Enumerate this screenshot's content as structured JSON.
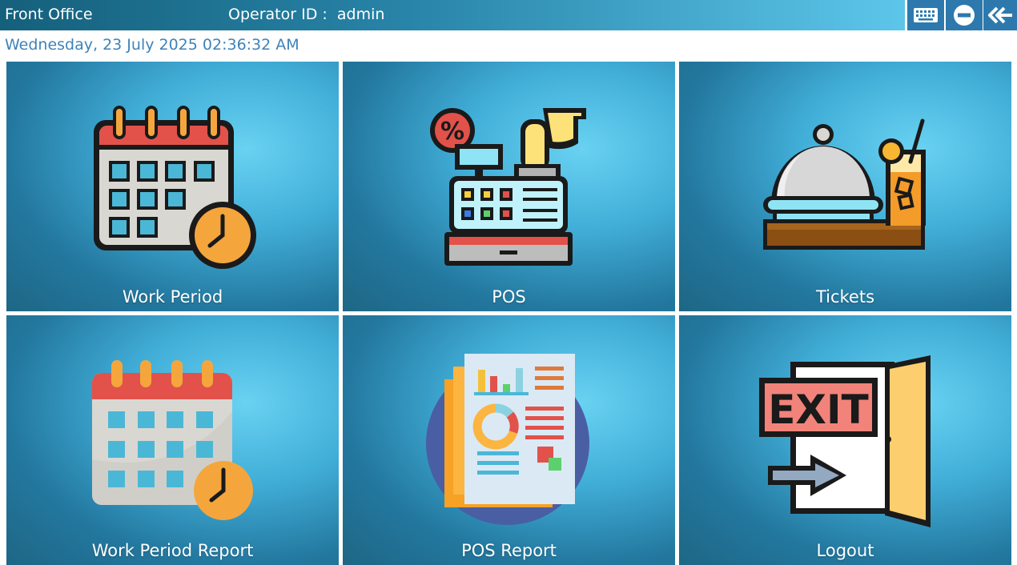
{
  "header": {
    "title": "Front Office",
    "operator_label": "Operator ID :",
    "operator_value": "admin",
    "datetime": "Wednesday, 23 July 2025 02:36:32 AM"
  },
  "toolbar": {
    "keyboard_icon": "keyboard-icon",
    "minimize_icon": "minimize-icon",
    "back_icon": "back-arrows-icon"
  },
  "tiles": [
    {
      "label": "Work Period",
      "icon": "calendar-clock-icon"
    },
    {
      "label": "POS",
      "icon": "cash-register-icon"
    },
    {
      "label": "Tickets",
      "icon": "food-cloche-icon"
    },
    {
      "label": "Work Period Report",
      "icon": "calendar-report-icon"
    },
    {
      "label": "POS Report",
      "icon": "report-document-icon"
    },
    {
      "label": "Logout",
      "icon": "exit-door-icon"
    }
  ],
  "colors": {
    "topbar_start": "#15607c",
    "topbar_end": "#5cc6ea",
    "button_bg": "#2d79ad",
    "datetime_text": "#3e83b8",
    "tile_light": "#69d2f2",
    "tile_dark": "#1e6685"
  }
}
